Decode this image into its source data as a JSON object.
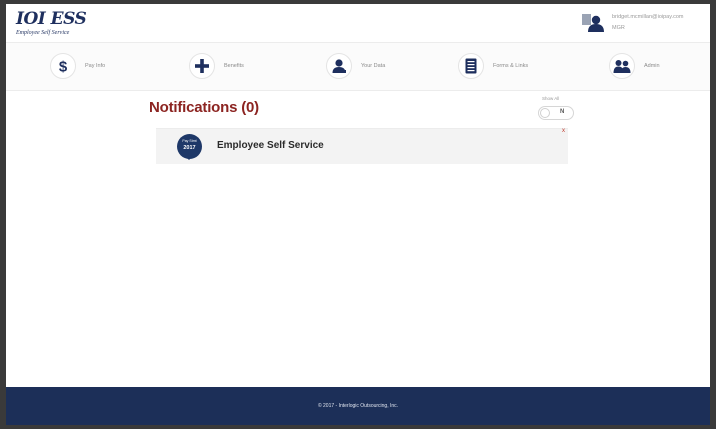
{
  "header": {
    "logo_main": "IOI ESS",
    "logo_sub": "Employee Self Service",
    "user_email": "bridget.mcmillan@ioipay.com",
    "user_role": "MGR"
  },
  "nav": {
    "items": [
      {
        "label": "Pay Info"
      },
      {
        "label": "Benefits"
      },
      {
        "label": "Your Data"
      },
      {
        "label": "Forms & Links"
      },
      {
        "label": "Admin"
      }
    ]
  },
  "main": {
    "title": "Notifications (0)",
    "toggle_label": "Show All",
    "toggle_value": "N",
    "notifications": [
      {
        "badge_top": "Pay Stmt",
        "badge_year": "2017",
        "title": "Employee Self Service",
        "close": "x"
      }
    ]
  },
  "footer": {
    "text": "© 2017 - Interlogic Outsourcing, Inc."
  },
  "colors": {
    "brand_navy": "#1e2f5e",
    "footer_bg": "#1c2f58",
    "title_red": "#8c2421",
    "badge_navy": "#1e3868"
  },
  "icons": [
    "dollar-icon",
    "plus-icon",
    "person-icon",
    "document-icon",
    "people-icon",
    "user-avatar-icon"
  ]
}
